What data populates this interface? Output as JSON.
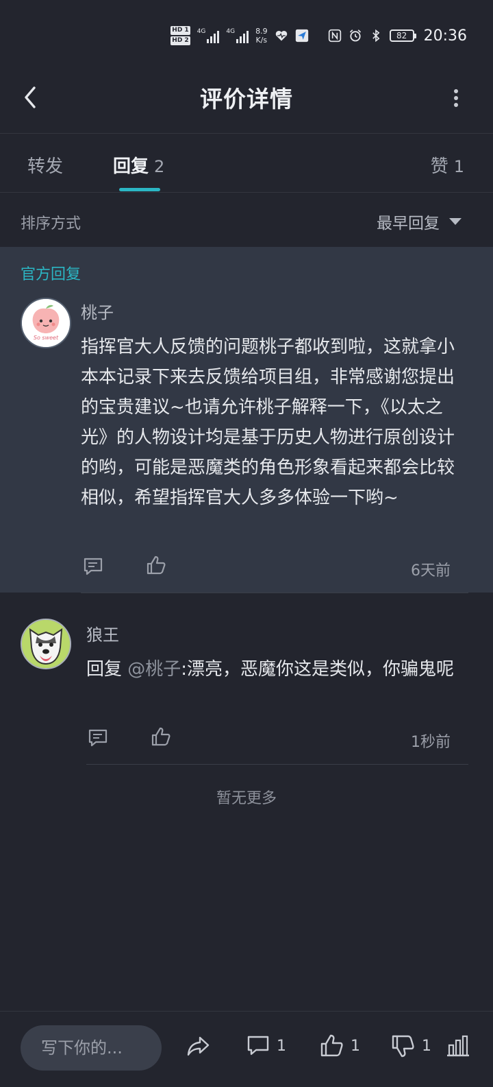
{
  "status_bar": {
    "network_speed_value": "8.9",
    "network_speed_unit": "K/s",
    "battery": "82",
    "time": "20:36",
    "hd1": "HD 1",
    "hd2": "HD 2",
    "net1": "4G",
    "net2": "4G"
  },
  "header": {
    "title": "评价详情",
    "back_icon": "chevron-left-icon",
    "more_icon": "more-vertical-icon"
  },
  "tabs": [
    {
      "label": "转发",
      "count": ""
    },
    {
      "label": "回复",
      "count": "2"
    },
    {
      "label": "赞",
      "count": "1"
    }
  ],
  "active_tab": "回复",
  "accent_color": "#2bb6c4",
  "sort": {
    "label": "排序方式",
    "value": "最早回复"
  },
  "official_reply": {
    "tag": "官方回复",
    "author": "桃子",
    "text": "指挥官大人反馈的问题桃子都收到啦，这就拿小本本记录下来去反馈给项目组，非常感谢您提出的宝贵建议~也请允许桃子解释一下，《以太之光》的人物设计均是基于历史人物进行原创设计的哟，可能是恶魔类的角色形象看起来都会比较相似，希望指挥官大人多多体验一下哟~",
    "time": "6天前",
    "avatar_caption": "So sweet"
  },
  "reply": {
    "author": "狼王",
    "prefix": "回复 ",
    "mention": "@桃子",
    "text": ":漂亮，恶魔你这是类似，你骗鬼呢",
    "time": "1秒前"
  },
  "no_more": "暂无更多",
  "bottom_bar": {
    "input_placeholder": "写下你的...",
    "comment_count": "1",
    "like_count": "1",
    "dislike_count": "1"
  }
}
